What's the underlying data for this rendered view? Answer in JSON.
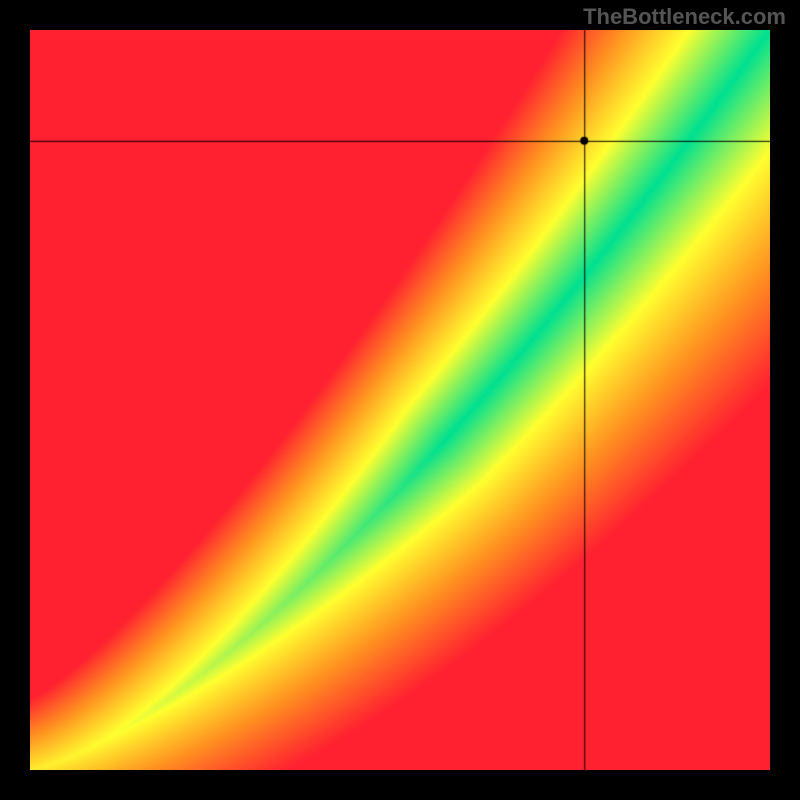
{
  "watermark": "TheBottleneck.com",
  "chart_data": {
    "type": "heatmap",
    "title": "",
    "xlabel": "",
    "ylabel": "",
    "xlim": [
      0,
      100
    ],
    "ylim": [
      0,
      100
    ],
    "description": "Bottleneck compatibility heatmap with diagonal green band indicating balanced CPU/GPU pairing; red regions indicate bottleneck; crosshair marker at intersection point.",
    "colormap": {
      "low": "#ff2030",
      "mid_low": "#ff9020",
      "mid": "#ffff30",
      "high": "#00e090"
    },
    "optimal_band": {
      "description": "Curved diagonal band from bottom-left to top-right where components are balanced",
      "curve_type": "power",
      "exponent": 1.4,
      "width_percent": 8
    },
    "marker": {
      "x_percent": 75,
      "y_percent": 85,
      "style": "crosshair"
    },
    "grid": false,
    "legend": false
  }
}
